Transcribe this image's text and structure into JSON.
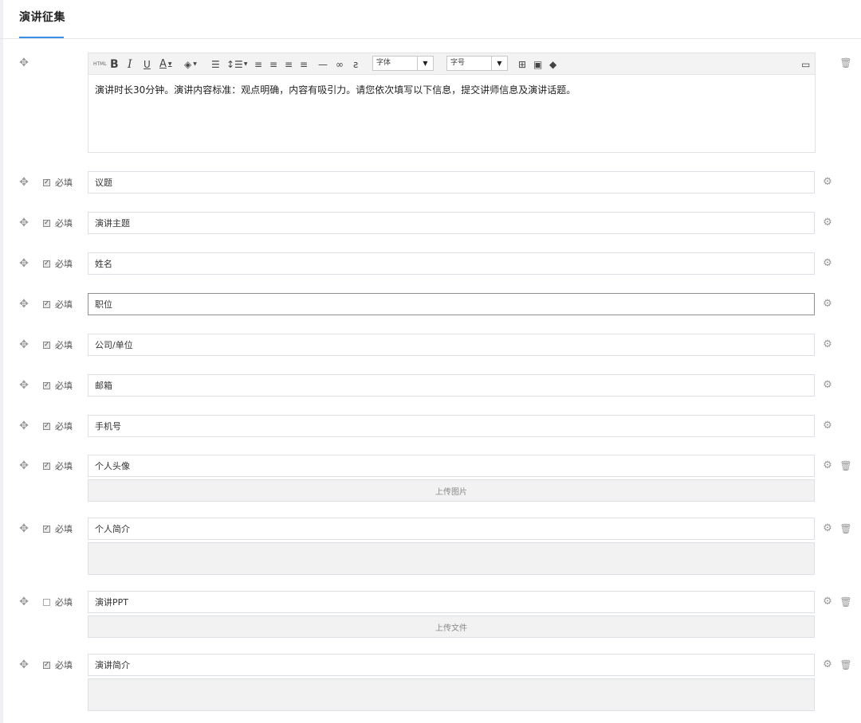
{
  "page": {
    "tab_title": "演讲征集"
  },
  "editor": {
    "toolbar": {
      "html_label": "HTML",
      "bold": "B",
      "italic": "I",
      "underline": "U",
      "font_color": "A",
      "font_family_placeholder": "字体",
      "font_size_placeholder": "字号"
    },
    "content": "演讲时长30分钟。演讲内容标准：观点明确，内容有吸引力。请您依次填写以下信息，提交讲师信息及演讲话题。"
  },
  "required_label": "必填",
  "fields": [
    {
      "value": "议题",
      "checked": true
    },
    {
      "value": "演讲主题",
      "checked": true
    },
    {
      "value": "姓名",
      "checked": true
    },
    {
      "value": "职位",
      "checked": true
    },
    {
      "value": "公司/单位",
      "checked": true
    },
    {
      "value": "邮箱",
      "checked": true
    },
    {
      "value": "手机号",
      "checked": true
    },
    {
      "value": "个人头像",
      "checked": true,
      "extra": "上传图片"
    },
    {
      "value": "个人简介",
      "checked": true
    },
    {
      "value": "演讲PPT",
      "checked": false,
      "extra": "上传文件"
    },
    {
      "value": "演讲简介",
      "checked": true
    }
  ],
  "icons": {
    "drag": "drag-handle-icon",
    "settings": "gear-icon",
    "delete": "trash-icon"
  }
}
